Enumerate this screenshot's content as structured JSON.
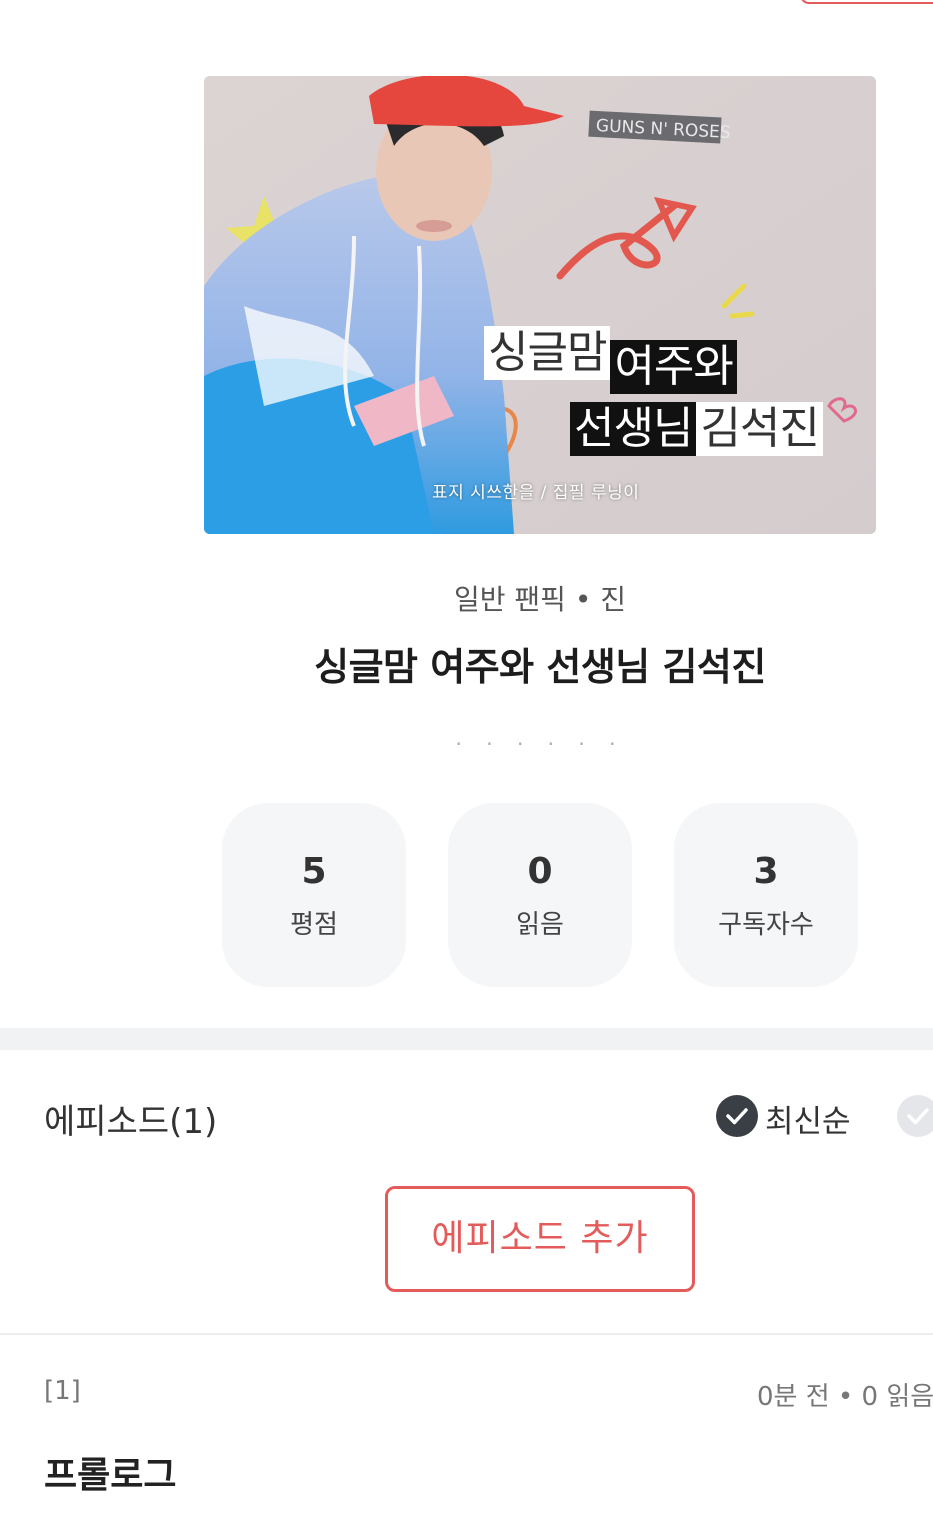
{
  "cover": {
    "badge_text": "GUNS N' ROSES",
    "line1_white": "싱글맘",
    "line1_black": "여주와",
    "line2_black": "선생님",
    "line2_white": "김석진",
    "credit": "표지 시쓰한을  /  집필 루닝이",
    "colors": {
      "jacket_blue": "#39a6e6",
      "cap_red": "#e5473f",
      "bg": "#d9d1d1"
    }
  },
  "work": {
    "genre": "일반 팬픽 • 진",
    "title": "싱글맘 여주와 선생님 김석진",
    "dots": "· · · · · ·"
  },
  "stats": [
    {
      "value": "5",
      "label": "평점"
    },
    {
      "value": "0",
      "label": "읽음"
    },
    {
      "value": "3",
      "label": "구독자수"
    }
  ],
  "episodes": {
    "header": "에피소드(1)",
    "sort_label": "최신순",
    "add_button": "에피소드 추가",
    "items": [
      {
        "num": "[1]",
        "meta": "0분 전 • 0 읽음",
        "title": "프롤로그"
      }
    ]
  },
  "theme": {
    "accent": "#e45b5b",
    "check_dark": "#3a3f45"
  }
}
